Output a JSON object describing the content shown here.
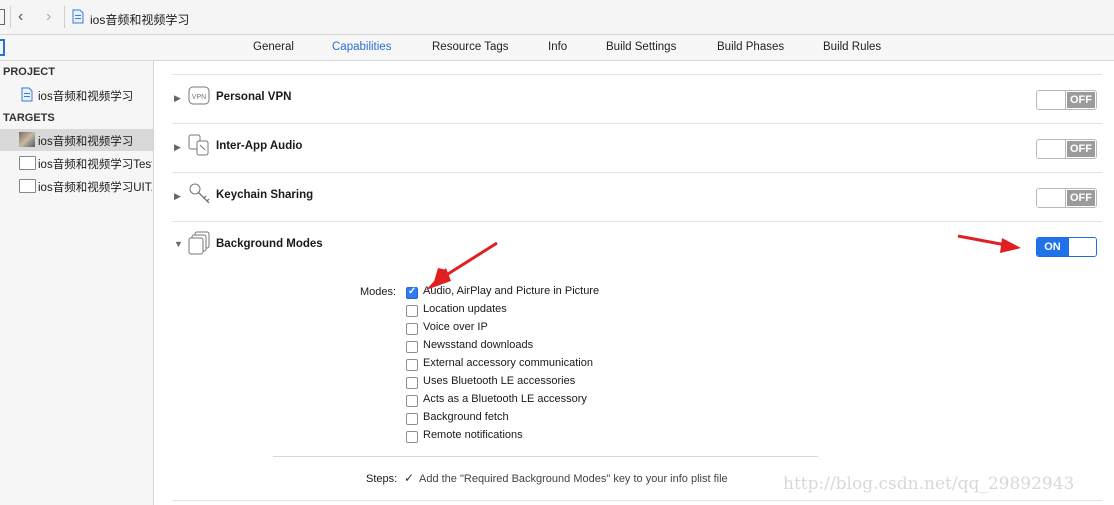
{
  "crumb": {
    "project_name": "ios音频和视频学习"
  },
  "tabs": [
    "General",
    "Capabilities",
    "Resource Tags",
    "Info",
    "Build Settings",
    "Build Phases",
    "Build Rules"
  ],
  "sidebar": {
    "project_header": "PROJECT",
    "project_item": "ios音频和视频学习",
    "targets_header": "TARGETS",
    "targets": [
      "ios音频和视频学习",
      "ios音频和视频学习Tests",
      "ios音频和视频学习UIT..."
    ]
  },
  "capabilities": [
    {
      "name": "Personal VPN",
      "state": "OFF",
      "icon": "vpn-icon"
    },
    {
      "name": "Inter-App Audio",
      "state": "OFF",
      "icon": "inter-app-audio-icon"
    },
    {
      "name": "Keychain Sharing",
      "state": "OFF",
      "icon": "keychain-icon"
    },
    {
      "name": "Background Modes",
      "state": "ON",
      "icon": "background-modes-icon"
    }
  ],
  "modes": {
    "label": "Modes:",
    "items": [
      {
        "text": "Audio, AirPlay and Picture in Picture",
        "checked": true
      },
      {
        "text": "Location updates",
        "checked": false
      },
      {
        "text": "Voice over IP",
        "checked": false
      },
      {
        "text": "Newsstand downloads",
        "checked": false
      },
      {
        "text": "External accessory communication",
        "checked": false
      },
      {
        "text": "Uses Bluetooth LE accessories",
        "checked": false
      },
      {
        "text": "Acts as a Bluetooth LE accessory",
        "checked": false
      },
      {
        "text": "Background fetch",
        "checked": false
      },
      {
        "text": "Remote notifications",
        "checked": false
      }
    ]
  },
  "steps": {
    "label": "Steps:",
    "text": "Add the \"Required Background Modes\" key to your info plist file"
  },
  "watermark": "http://blog.csdn.net/qq_29892943",
  "colors": {
    "accent": "#2a6fd6",
    "toggle_on": "#1f72ea",
    "annotation_arrow": "#e02020"
  }
}
